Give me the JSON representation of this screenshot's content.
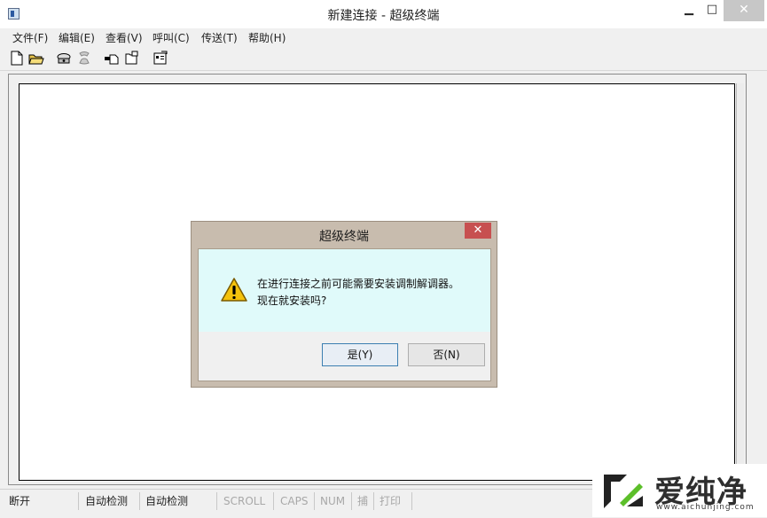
{
  "window": {
    "title": "新建连接 - 超级终端",
    "minimize": "▁",
    "maximize": "□",
    "close": "✕"
  },
  "menu": [
    {
      "label": "文件(F)"
    },
    {
      "label": "编辑(E)"
    },
    {
      "label": "查看(V)"
    },
    {
      "label": "呼叫(C)"
    },
    {
      "label": "传送(T)"
    },
    {
      "label": "帮助(H)"
    }
  ],
  "toolbar": {
    "icons": [
      "new-document-icon",
      "open-folder-icon",
      "call-icon",
      "disconnect-icon",
      "send-icon",
      "receive-icon",
      "properties-icon"
    ]
  },
  "dialog": {
    "title": "超级终端",
    "close": "✕",
    "message_line1": "在进行连接之前可能需要安装调制解调器。",
    "message_line2": "现在就安装吗?",
    "yes_label": "是(Y)",
    "no_label": "否(N)",
    "icon": "warning-icon"
  },
  "statusbar": {
    "cells": [
      "断开",
      "自动检测",
      "自动检测",
      "SCROLL",
      "CAPS",
      "NUM",
      "捕",
      "打印"
    ]
  },
  "watermark": {
    "text": "爱纯净",
    "url": "www.aichunjing.com"
  },
  "colors": {
    "dialog_message_bg": "#e0fafa",
    "dialog_frame": "#c8bcae",
    "close_red": "#c75050"
  }
}
